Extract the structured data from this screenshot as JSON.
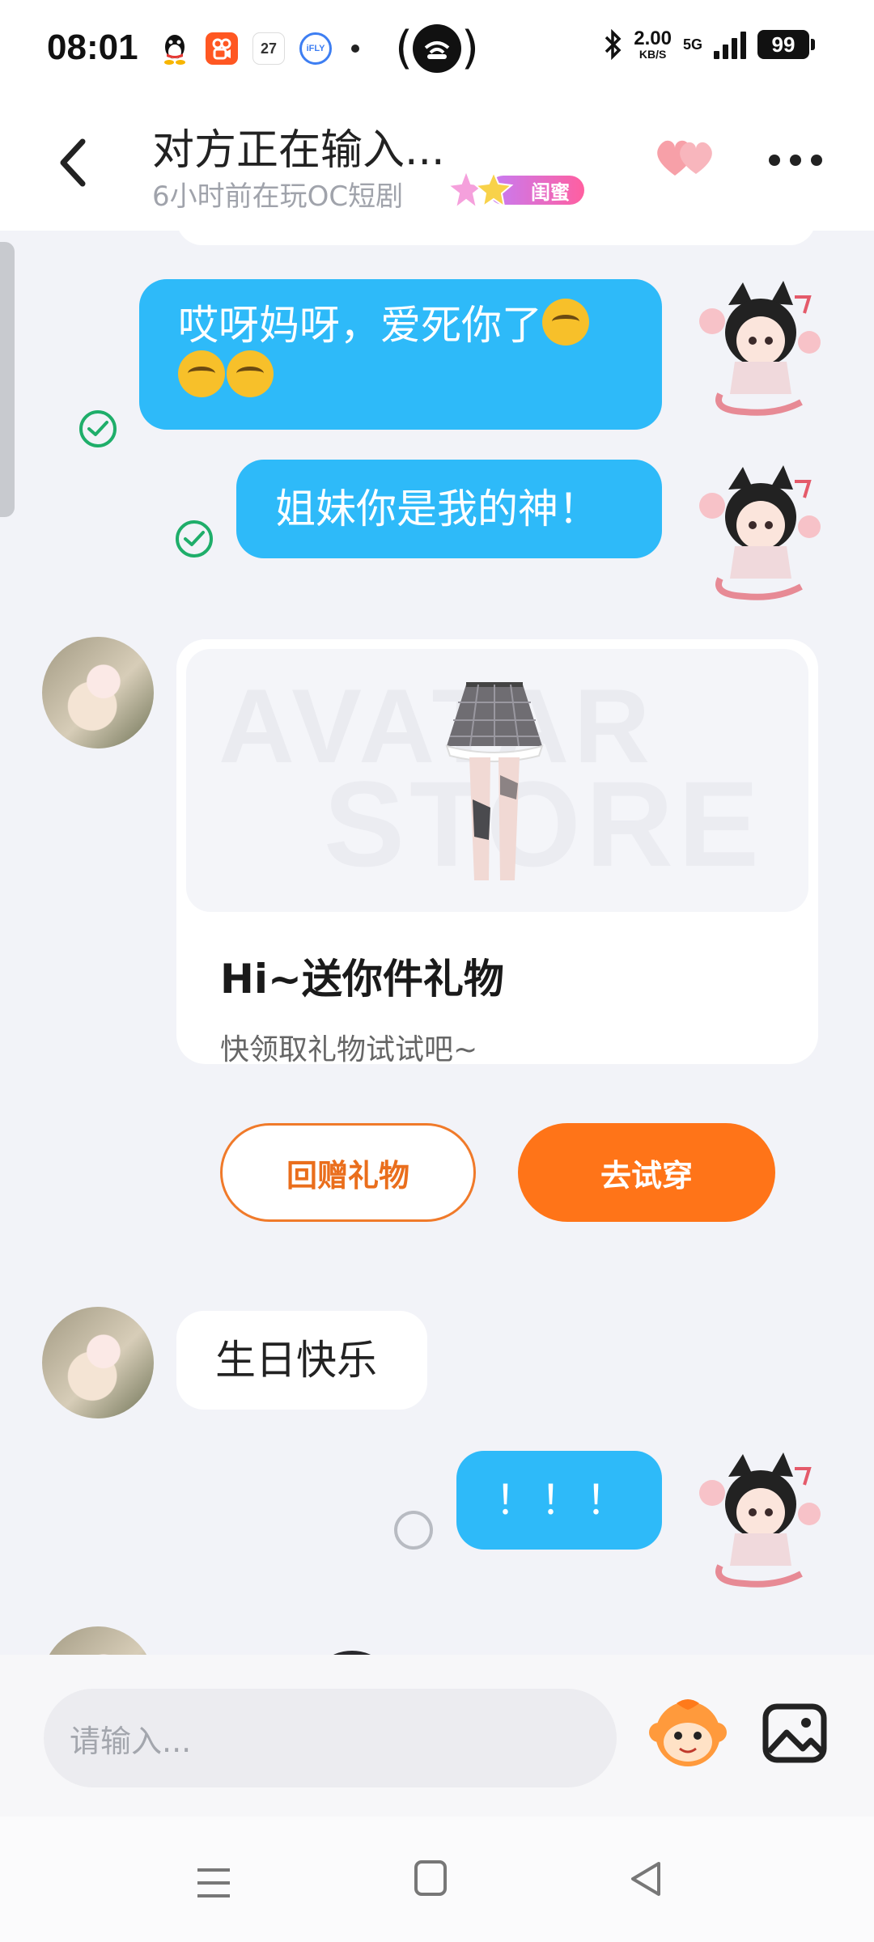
{
  "status_bar": {
    "time": "08:01",
    "apps": [
      "qq-icon",
      "kuaishou-icon",
      "calendar-icon",
      "ifly-icon"
    ],
    "calendar_day": "27",
    "ifly_label": "iFLY",
    "net_speed_value": "2.00",
    "net_speed_unit": "KB/S",
    "network": "5G",
    "battery": "99"
  },
  "header": {
    "title": "对方正在输入...",
    "subtitle": "6小时前在玩OC短剧",
    "badge": "闺蜜"
  },
  "messages": [
    {
      "side": "me",
      "text": "哎呀妈呀，爱死你了",
      "emoji_count_line1": 1,
      "emoji_count_line2": 2,
      "status": "read"
    },
    {
      "side": "me",
      "text": "姐妹你是我的神！",
      "status": "read"
    },
    {
      "side": "friend",
      "type": "gift-card"
    },
    {
      "side": "friend",
      "text": "生日快乐"
    },
    {
      "side": "me",
      "text": "！！！",
      "status": "sending"
    }
  ],
  "gift_card": {
    "watermark_line1": "AVATAR",
    "watermark_line2": "STORE",
    "title": "Hi~送你件礼物",
    "desc": "快领取礼物试试吧~",
    "return_button": "回赠礼物",
    "try_button": "去试穿"
  },
  "input": {
    "placeholder": "请输入..."
  },
  "colors": {
    "sent_bubble": "#2ebaf9",
    "accent_orange": "#ff7418",
    "read_check": "#1fae6a",
    "background": "#f2f3f8"
  }
}
